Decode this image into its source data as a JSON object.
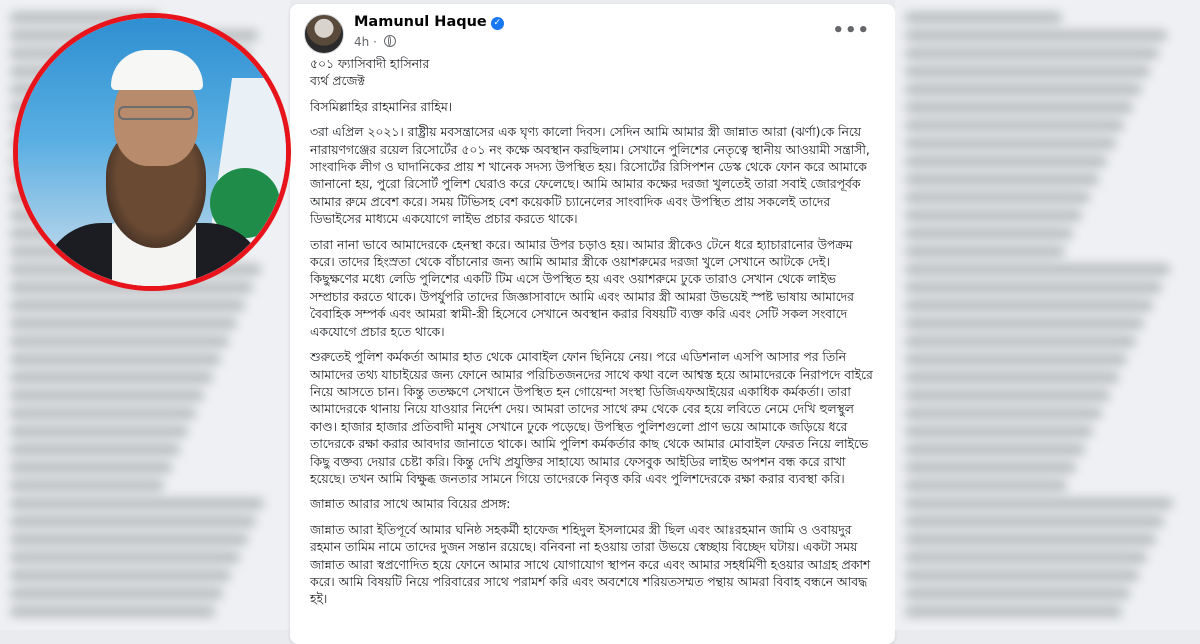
{
  "post": {
    "author": "Mamunul Haque",
    "time": "4h",
    "more_label": "•••",
    "title_line1": "৫০১ ফ্যাসিবাদী হাসিনার",
    "title_line2": "ব্যর্থ প্রজেক্ট",
    "paragraphs": [
      "বিসমিল্লাহির রাহমানির রাহিম।",
      "৩রা এপ্রিল ২০২১। রাষ্ট্রীয় মবসন্ত্রাসের এক ঘৃণ্য কালো দিবস। সেদিন আমি আমার স্ত্রী জান্নাত আরা (ঝর্ণা)কে নিয়ে নারায়ণগঞ্জের রয়েল রিসোর্টের ৫০১ নং কক্ষে অবস্থান করছিলাম। সেখানে পুলিশের নেতৃত্বে স্থানীয় আওয়ামী সন্ত্রাসী, সাংবাদিক লীগ ও ঘাদানিকের প্রায় শ খানেক সদস্য উপস্থিত হয়। রিসোর্টের রিসিপশন ডেস্ক থেকে ফোন করে আমাকে জানানো হয়, পুরো রিসোর্ট পুলিশ ঘেরাও করে ফেলেছে। আমি আমার কক্ষের দরজা খুলতেই তারা সবাই জোরপূর্বক আমার রুমে প্রবেশ করে। সময় টিভিসহ বেশ কয়েকটি চ্যানেলের সাংবাদিক এবং উপস্থিত প্রায় সকলেই তাদের ডিভাইসের মাধ্যমে একযোগে লাইভ প্রচার করতে থাকে।",
      "তারা নানা ভাবে আমাদেরকে হেনস্থা করে। আমার উপর চড়াও হয়। আমার স্ত্রীকেও টেনে ধরে হ্যাচারানোর উপক্রম করে। তাদের হিংস্রতা থেকে বাঁচানোর জন্য আমি আমার স্ত্রীকে ওয়াশরুমের দরজা খুলে সেখানে আটকে দেই। কিছুক্ষণের মধ্যে লেডি পুলিশের একটি টিম এসে উপস্থিত হয় এবং ওয়াশরুমে ঢুকে তারাও সেখান থেকে লাইভ সম্প্রচার করতে থাকে। উপর্যুপরি তাদের জিজ্ঞাসাবাদে আমি এবং আমার স্ত্রী আমরা উভয়েই স্পষ্ট ভাষায় আমাদের বৈবাহিক সম্পর্ক এবং আমরা স্বামী-স্ত্রী হিসেবে সেখানে অবস্থান করার বিষয়টি ব্যক্ত করি এবং সেটি সকল সংবাদে একযোগে প্রচার হতে থাকে।",
      "শুরুতেই পুলিশ কর্মকর্তা আমার হাত থেকে মোবাইল ফোন ছিনিয়ে নেয়। পরে এডিশনাল এসপি আসার পর তিনি আমাদের তথ্য যাচাইয়ের জন্য ফোনে আমার পরিচিতজনদের সাথে কথা বলে আশ্বস্ত হয়ে আমাদেরকে নিরাপদে বাইরে নিয়ে আসতে চান। কিন্তু ততক্ষণে সেখানে উপস্থিত হন গোয়েন্দা সংস্থা ডিজিএফআইয়ের একাধিক কর্মকর্তা। তারা আমাদেরকে থানায় নিয়ে যাওয়ার নির্দেশ দেয়। আমরা তাদের সাথে রুম থেকে বের হয়ে লবিতে নেমে দেখি হুলস্থুল কাণ্ড। হাজার হাজার প্রতিবাদী মানুষ সেখানে ঢুকে পড়েছে। উপস্থিত পুলিশগুলো প্রাণ ভয়ে আমাকে জড়িয়ে ধরে তাদেরকে রক্ষা করার আবদার জানাতে থাকে। আমি পুলিশ কর্মকর্তার কাছ থেকে আমার মোবাইল ফেরত নিয়ে লাইভে কিছু বক্তব্য দেয়ার চেষ্টা করি। কিন্তু দেখি প্রযুক্তির সাহায্যে আমার ফেসবুক আইডির লাইভ অপশন বন্ধ করে রাখা হয়েছে। তখন আমি বিক্ষুব্ধ জনতার সামনে গিয়ে তাদেরকে নিবৃত্ত করি এবং পুলিশদেরকে রক্ষা করার ব্যবস্থা করি।",
      "জান্নাত আরার সাথে আমার বিয়ের প্রসঙ্গ:",
      "জান্নাত আরা ইতিপূর্বে আমার ঘনিষ্ঠ সহকর্মী হাফেজ শহিদুল ইসলামের স্ত্রী ছিল এবং আঃরহমান জামি ও ওবায়দুর রহমান তামিম নামে তাদের দুজন সন্তান রয়েছে। বনিবনা না হওয়ায় তারা উভয়ে স্বেচ্ছায় বিচ্ছেদ ঘটায়। একটা সময় জান্নাত আরা স্বপ্রণোদিত হয়ে ফোনে আমার সাথে যোগাযোগ স্থাপন করে এবং আমার সহধর্মিণী হওয়ার আগ্রহ প্রকাশ করে। আমি বিষয়টি নিয়ে পরিবারের সাথে পরামর্শ করি এবং অবশেষে শরিয়তসম্মত পন্থায় আমরা বিবাহ বন্ধনে আবদ্ধ হই।"
    ]
  },
  "colors": {
    "ring": "#e8141b",
    "verified": "#1877f2",
    "text": "#1c1e21",
    "meta": "#65676b"
  }
}
